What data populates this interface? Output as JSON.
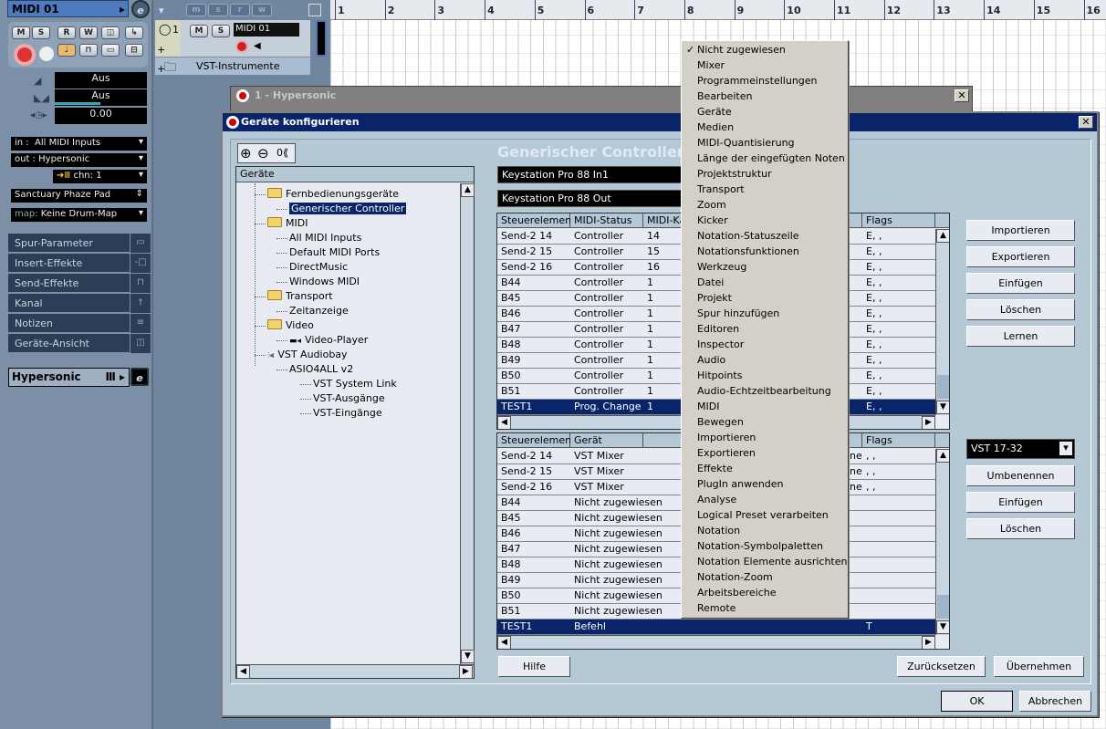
{
  "inspector": {
    "track_name": "MIDI 01",
    "buttons": [
      "M",
      "S",
      "R",
      "W"
    ],
    "volume": "Aus",
    "pan": "Aus",
    "delay": "0.00",
    "in_label": "in :",
    "in_value": "All MIDI Inputs",
    "out_label": "out :",
    "out_value": "Hypersonic",
    "chn_label": "chn:",
    "chn_value": "1",
    "program": "Sanctuary Phaze Pad",
    "map_label": "map:",
    "map_value": "Keine Drum-Map",
    "sections": [
      {
        "label": "Spur-Parameter",
        "icon": "track-params-icon"
      },
      {
        "label": "Insert-Effekte",
        "icon": "insert-icon"
      },
      {
        "label": "Send-Effekte",
        "icon": "send-icon"
      },
      {
        "label": "Kanal",
        "icon": "channel-icon"
      },
      {
        "label": "Notizen",
        "icon": "notes-icon"
      },
      {
        "label": "Geräte-Ansicht",
        "icon": "device-view-icon"
      }
    ],
    "instrument": "Hypersonic"
  },
  "tracklist": {
    "header_buttons": [
      "m",
      "s",
      "r",
      "w"
    ],
    "track_number": "1",
    "track_name": "MIDI 01",
    "track_buttons": [
      "M",
      "S"
    ],
    "folder_name": "VST-Instrumente"
  },
  "ruler": {
    "bars": [
      "1",
      "2",
      "3",
      "4",
      "5",
      "6",
      "7",
      "8",
      "9",
      "10",
      "11",
      "12",
      "13",
      "14",
      "15",
      "16"
    ]
  },
  "hypersonic_window": {
    "title": "1 - Hypersonic"
  },
  "dialog": {
    "title": "Geräte konfigurieren",
    "toolbar_ok": "0⟪",
    "tree_header": "Geräte",
    "tree": [
      {
        "label": "Fernbedienungsgeräte",
        "level": 1,
        "folder": true
      },
      {
        "label": "Generischer Controller",
        "level": 2,
        "selected": true
      },
      {
        "label": "MIDI",
        "level": 1,
        "folder": true
      },
      {
        "label": "All MIDI Inputs",
        "level": 2
      },
      {
        "label": "Default MIDI Ports",
        "level": 2
      },
      {
        "label": "DirectMusic",
        "level": 2
      },
      {
        "label": "Windows MIDI",
        "level": 2
      },
      {
        "label": "Transport",
        "level": 1,
        "folder": true
      },
      {
        "label": "Zeitanzeige",
        "level": 2
      },
      {
        "label": "Video",
        "level": 1,
        "folder": true
      },
      {
        "label": "Video-Player",
        "level": 2,
        "video": true
      },
      {
        "label": "VST Audiobay",
        "level": 1,
        "audio": true
      },
      {
        "label": "ASIO4ALL v2",
        "level": 2
      },
      {
        "label": "VST System Link",
        "level": 3
      },
      {
        "label": "VST-Ausgänge",
        "level": 3
      },
      {
        "label": "VST-Eingänge",
        "level": 3
      }
    ],
    "controller_title": "Generischer Controller",
    "midi_input": "Keystation Pro 88 In1",
    "midi_output": "Keystation Pro 88 Out",
    "table1": {
      "headers": [
        "Steuerelement",
        "MIDI-Status",
        "MIDI-Kanal",
        "",
        "Flags"
      ],
      "rows": [
        [
          "Send-2 14",
          "Controller",
          "14",
          "",
          "E, ,"
        ],
        [
          "Send-2 15",
          "Controller",
          "15",
          "",
          "E, ,"
        ],
        [
          "Send-2 16",
          "Controller",
          "16",
          "",
          "E, ,"
        ],
        [
          "B44",
          "Controller",
          "1",
          "",
          "E, ,"
        ],
        [
          "B45",
          "Controller",
          "1",
          "",
          "E, ,"
        ],
        [
          "B46",
          "Controller",
          "1",
          "",
          "E, ,"
        ],
        [
          "B47",
          "Controller",
          "1",
          "",
          "E, ,"
        ],
        [
          "B48",
          "Controller",
          "1",
          "",
          "E, ,"
        ],
        [
          "B49",
          "Controller",
          "1",
          "",
          "E, ,"
        ],
        [
          "B50",
          "Controller",
          "1",
          "",
          "E, ,"
        ],
        [
          "B51",
          "Controller",
          "1",
          "",
          "E, ,"
        ],
        [
          "TEST1",
          "Prog. Change",
          "1",
          "",
          "E, ,"
        ]
      ],
      "selected": 11
    },
    "table2": {
      "headers": [
        "Steuerelement",
        "Gerät",
        "",
        "",
        "Flags"
      ],
      "rows": [
        [
          "Send-2 14",
          "VST Mixer",
          "",
          "ne",
          ", ,"
        ],
        [
          "Send-2 15",
          "VST Mixer",
          "",
          "ne",
          ", ,"
        ],
        [
          "Send-2 16",
          "VST Mixer",
          "",
          "ne",
          ", ,"
        ],
        [
          "B44",
          "Nicht zugewiesen",
          "",
          "",
          ""
        ],
        [
          "B45",
          "Nicht zugewiesen",
          "",
          "",
          ""
        ],
        [
          "B46",
          "Nicht zugewiesen",
          "",
          "",
          ""
        ],
        [
          "B47",
          "Nicht zugewiesen",
          "",
          "",
          ""
        ],
        [
          "B48",
          "Nicht zugewiesen",
          "",
          "",
          ""
        ],
        [
          "B49",
          "Nicht zugewiesen",
          "",
          "",
          ""
        ],
        [
          "B50",
          "Nicht zugewiesen",
          "",
          "",
          ""
        ],
        [
          "B51",
          "Nicht zugewiesen",
          "",
          "",
          ""
        ],
        [
          "TEST1",
          "Befehl",
          "",
          "",
          "T"
        ]
      ],
      "selected": 11
    },
    "buttons1": [
      "Importieren",
      "Exportieren",
      "Einfügen",
      "Löschen",
      "Lernen"
    ],
    "bank_select": "VST 17-32",
    "buttons2": [
      "Umbenennen",
      "Einfügen",
      "Löschen"
    ],
    "help": "Hilfe",
    "reset": "Zurücksetzen",
    "apply": "Übernehmen",
    "ok": "OK",
    "cancel": "Abbrechen"
  },
  "context_menu": {
    "checked_index": 0,
    "items": [
      "Nicht zugewiesen",
      "Mixer",
      "Programmeinstellungen",
      "Bearbeiten",
      "Geräte",
      "Medien",
      "MIDI-Quantisierung",
      "Länge der eingefügten Noten",
      "Projektstruktur",
      "Transport",
      "Zoom",
      "Kicker",
      "Notation-Statuszeile",
      "Notationsfunktionen",
      "Werkzeug",
      "Datei",
      "Projekt",
      "Spur hinzufügen",
      "Editoren",
      "Inspector",
      "Audio",
      "Hitpoints",
      "Audio-Echtzeitbearbeitung",
      "MIDI",
      "Bewegen",
      "Importieren",
      "Exportieren",
      "Effekte",
      "PlugIn anwenden",
      "Analyse",
      "Logical Preset verarbeiten",
      "Notation",
      "Notation-Symbolpaletten",
      "Notation Elemente ausrichten",
      "Notation-Zoom",
      "Arbeitsbereiche",
      "Remote"
    ]
  }
}
